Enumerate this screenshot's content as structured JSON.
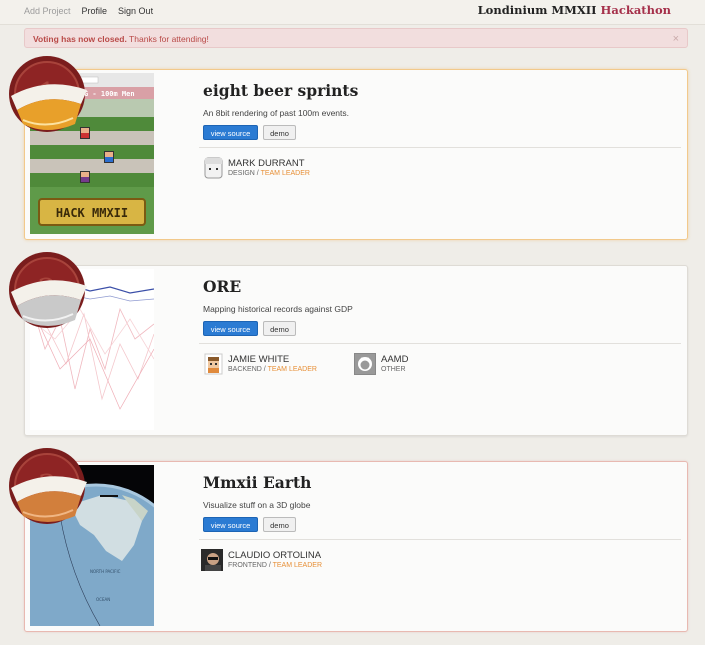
{
  "nav": {
    "items": [
      {
        "label": "Add Project"
      },
      {
        "label": "Profile"
      },
      {
        "label": "Sign Out"
      }
    ]
  },
  "brand": {
    "title": "Londinium MMXII",
    "accent": "Hackathon",
    "accent_color": "#a5304a"
  },
  "alert": {
    "strong": "Voting has now closed.",
    "text": "Thanks for attending!",
    "close": "×"
  },
  "projects": [
    {
      "rank": "1",
      "medal": "gold-medal-icon",
      "title": "eight beer sprints",
      "description": "An 8bit rendering of past 100m events.",
      "source_label": "view source",
      "demo_label": "demo",
      "thumb_banner": "HACK MMXII",
      "thumb_header": "G - 100m Men",
      "members": [
        {
          "name": "MARK DURRANT",
          "role": "DESIGN",
          "sep": " / ",
          "lead": "TEAM LEADER",
          "avatar": "pixel-face-avatar"
        }
      ]
    },
    {
      "rank": "2",
      "medal": "silver-medal-icon",
      "title": "ORE",
      "description": "Mapping historical records against GDP",
      "source_label": "view source",
      "demo_label": "demo",
      "members": [
        {
          "name": "JAMIE WHITE",
          "role": "BACKEND",
          "sep": " / ",
          "lead": "TEAM LEADER",
          "avatar": "pixel-person-avatar"
        },
        {
          "name": "AAMD",
          "role": "OTHER",
          "sep": "",
          "lead": "",
          "avatar": "github-octocat-avatar"
        }
      ]
    },
    {
      "rank": "3",
      "medal": "bronze-medal-icon",
      "title": "Mmxii Earth",
      "description": "Visualize stuff on a 3D globe",
      "source_label": "view source",
      "demo_label": "demo",
      "members": [
        {
          "name": "CLAUDIO ORTOLINA",
          "role": "FRONTEND",
          "sep": " / ",
          "lead": "TEAM LEADER",
          "avatar": "photo-avatar"
        }
      ]
    }
  ],
  "colors": {
    "gold": "#e8a02a",
    "silver": "#c9c9c9",
    "bronze": "#d27f3c",
    "medal_ring": "#7a1d1d",
    "lead": "#e78f36",
    "primary": "#2b7bd3"
  }
}
